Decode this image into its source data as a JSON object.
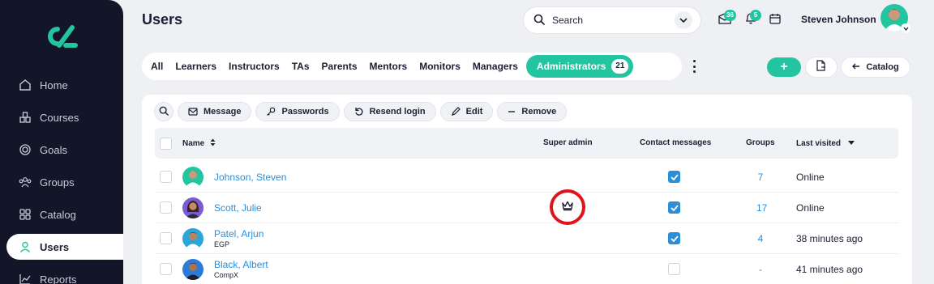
{
  "app": {
    "page_title": "Users"
  },
  "sidebar": {
    "items": [
      {
        "label": "Home",
        "icon": "home-icon",
        "active": false
      },
      {
        "label": "Courses",
        "icon": "courses-icon",
        "active": false
      },
      {
        "label": "Goals",
        "icon": "goals-icon",
        "active": false
      },
      {
        "label": "Groups",
        "icon": "groups-icon",
        "active": false
      },
      {
        "label": "Catalog",
        "icon": "catalog-icon",
        "active": false
      },
      {
        "label": "Users",
        "icon": "user-icon",
        "active": true
      },
      {
        "label": "Reports",
        "icon": "reports-icon",
        "active": false
      }
    ]
  },
  "header": {
    "search_label": "Search",
    "messages_count": "36",
    "notifications_count": "5",
    "user_name": "Steven Johnson"
  },
  "tabs": [
    {
      "label": "All"
    },
    {
      "label": "Learners"
    },
    {
      "label": "Instructors"
    },
    {
      "label": "TAs"
    },
    {
      "label": "Parents"
    },
    {
      "label": "Mentors"
    },
    {
      "label": "Monitors"
    },
    {
      "label": "Managers"
    },
    {
      "label": "Administrators",
      "count": "21",
      "active": true
    }
  ],
  "toolbar": {
    "add_label": "+",
    "catalog_label": "Catalog"
  },
  "actions": {
    "message": "Message",
    "passwords": "Passwords",
    "resend_login": "Resend login",
    "edit": "Edit",
    "remove": "Remove"
  },
  "table": {
    "columns": {
      "name": "Name",
      "super_admin": "Super admin",
      "contact_messages": "Contact messages",
      "groups": "Groups",
      "last_visited": "Last visited"
    },
    "rows": [
      {
        "name": "Johnson, Steven",
        "sub": "",
        "super_admin": false,
        "contact": true,
        "groups": "7",
        "last_visited": "Online"
      },
      {
        "name": "Scott, Julie",
        "sub": "",
        "super_admin": true,
        "contact": true,
        "groups": "17",
        "last_visited": "Online"
      },
      {
        "name": "Patel, Arjun",
        "sub": "EGP",
        "super_admin": false,
        "contact": true,
        "groups": "4",
        "last_visited": "38 minutes ago"
      },
      {
        "name": "Black, Albert",
        "sub": "CompX",
        "super_admin": false,
        "contact": false,
        "groups": "-",
        "last_visited": "41 minutes ago"
      }
    ]
  },
  "colors": {
    "accent": "#23c4a0",
    "link": "#2a8ed9",
    "sidebar": "#131628",
    "highlight_ring": "#e0141c"
  }
}
